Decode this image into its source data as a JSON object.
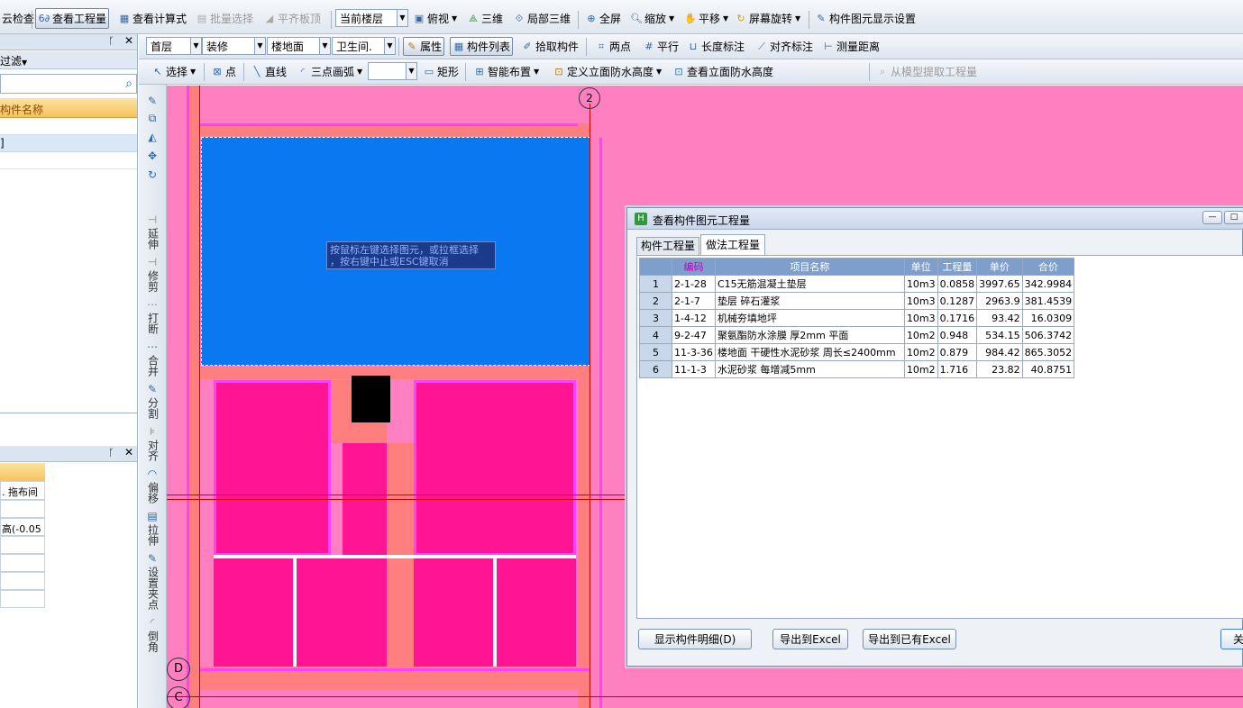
{
  "toolbar1": {
    "check": "云检查",
    "view_qty": "查看工程量",
    "view_formula": "查看计算式",
    "batch_select": "批量选择",
    "flat_top": "平齐板顶",
    "floor_select": "当前楼层",
    "top_view": "俯视",
    "view3d": "三维",
    "local3d": "局部三维",
    "fullscreen": "全屏",
    "zoom": "缩放",
    "pan": "平移",
    "rotate": "屏幕旋转",
    "display_settings": "构件图元显示设置"
  },
  "toolbar2": {
    "floor": "首层",
    "category": "装修",
    "type": "楼地面",
    "component": "卫生间.",
    "attr": "属性",
    "list": "构件列表",
    "pick": "拾取构件",
    "two_points": "两点",
    "parallel": "平行",
    "length_dim": "长度标注",
    "align_dim": "对齐标注",
    "measure": "测量距离"
  },
  "toolbar3": {
    "select": "选择",
    "point": "点",
    "line": "直线",
    "arc": "三点画弧",
    "rect": "矩形",
    "smart": "智能布置",
    "define_height": "定义立面防水高度",
    "view_height": "查看立面防水高度",
    "extract": "从模型提取工程量"
  },
  "left_panel": {
    "filter": "过滤",
    "col_header": "构件名称",
    "row2": "]",
    "bottom_cell1": ". 拖布间",
    "bottom_cell2": "高(-0.05"
  },
  "side_tools": [
    "延伸",
    "修剪",
    "打断",
    "合并",
    "分割",
    "对齐",
    "偏移",
    "拉伸",
    "设置夹点",
    "倒角"
  ],
  "canvas": {
    "hint_line1": "按鼠标左键选择图元，或拉框选择",
    "hint_line2": "，按右键中止或ESC键取消",
    "axis_top": "2",
    "axis_d": "D",
    "axis_c": "C"
  },
  "dialog": {
    "title": "查看构件图元工程量",
    "tab1": "构件工程量",
    "tab2": "做法工程量",
    "headers": [
      "",
      "编码",
      "项目名称",
      "单位",
      "工程量",
      "单价",
      "合价"
    ],
    "rows": [
      [
        "1",
        "2-1-28",
        "C15无筋混凝土垫层",
        "10m3",
        "0.0858",
        "3997.65",
        "342.9984"
      ],
      [
        "2",
        "2-1-7",
        "垫层 碎石灌浆",
        "10m3",
        "0.1287",
        "2963.9",
        "381.4539"
      ],
      [
        "3",
        "1-4-12",
        "机械夯填地坪",
        "10m3",
        "0.1716",
        "93.42",
        "16.0309"
      ],
      [
        "4",
        "9-2-47",
        "聚氨酯防水涂膜 厚2mm 平面",
        "10m2",
        "0.948",
        "534.15",
        "506.3742"
      ],
      [
        "5",
        "11-3-36",
        "楼地面 干硬性水泥砂浆 周长≤2400mm",
        "10m2",
        "0.879",
        "984.42",
        "865.3052"
      ],
      [
        "6",
        "11-1-3",
        "水泥砂浆 每增减5mm",
        "10m2",
        "1.716",
        "23.82",
        "40.8751"
      ]
    ],
    "btn_detail": "显示构件明细(D)",
    "btn_export": "导出到Excel",
    "btn_export_existing": "导出到已有Excel",
    "btn_close": "关"
  },
  "colors": {
    "canvas_bg": "#ff80c0",
    "slab_blue": "#0a78f0",
    "room_pink": "#ff1493",
    "wall_orange": "#ff7f7f",
    "wall_magenta": "#ff40ff"
  }
}
